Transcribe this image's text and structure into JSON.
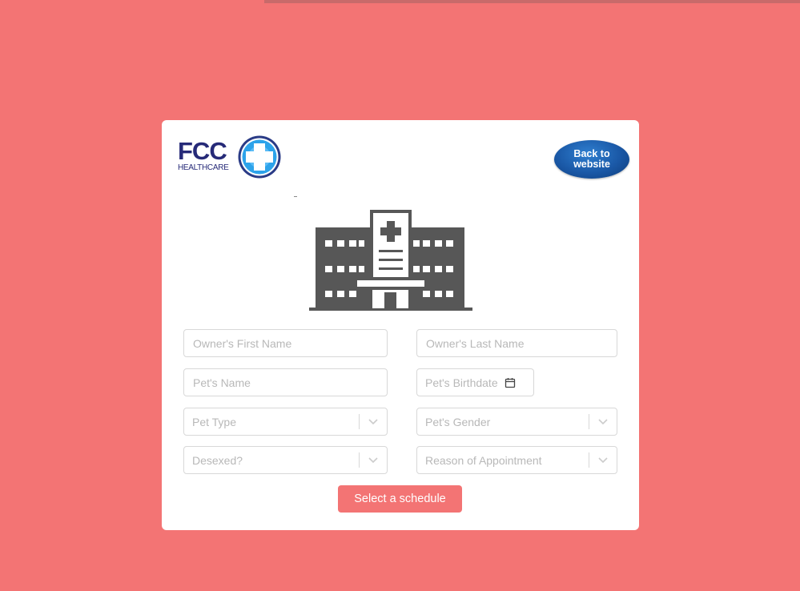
{
  "brand": {
    "logo_main": "FCC",
    "logo_sub": "HEALTHCARE"
  },
  "header": {
    "back_button": "Back to website"
  },
  "form": {
    "owner_first_name_placeholder": "Owner's First Name",
    "owner_last_name_placeholder": "Owner's Last Name",
    "pet_name_placeholder": "Pet's Name",
    "pet_birthdate_placeholder": "Pet's Birthdate",
    "pet_type_placeholder": "Pet Type",
    "pet_gender_placeholder": "Pet's Gender",
    "desexed_placeholder": "Desexed?",
    "reason_placeholder": "Reason of Appointment",
    "submit_label": "Select a schedule"
  },
  "icons": {
    "hero": "hospital-building-icon",
    "logo": "medical-cross-icon",
    "date": "calendar-icon",
    "dropdown": "chevron-down-icon"
  },
  "colors": {
    "background": "#f37474",
    "card": "#ffffff",
    "brand_navy": "#262a78",
    "back_button": "#1a58a6",
    "hospital_icon": "#575757",
    "primary_button": "#f37474"
  }
}
